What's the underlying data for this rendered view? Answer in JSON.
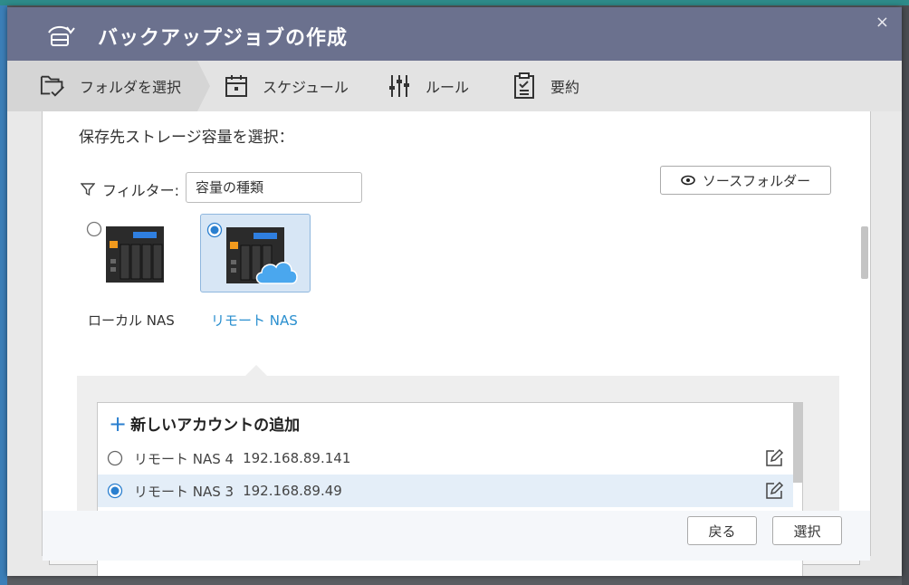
{
  "window": {
    "title": "バックアップジョブの作成",
    "close": "×"
  },
  "steps": [
    {
      "label": "フォルダを選択",
      "icon": "folder-check-icon"
    },
    {
      "label": "スケジュール",
      "icon": "calendar-icon"
    },
    {
      "label": "ルール",
      "icon": "sliders-icon"
    },
    {
      "label": "要約",
      "icon": "clipboard-icon"
    }
  ],
  "content": {
    "section_label": "保存先ストレージ容量を選択：",
    "filter_label": "フィルター:",
    "filter_value": "容量の種類",
    "source_folder_button": "ソースフォルダー",
    "storage_options": [
      {
        "label": "ローカル NAS",
        "selected": false
      },
      {
        "label": "リモート NAS",
        "selected": true
      }
    ],
    "add_account": "新しいアカウントの追加",
    "accounts": [
      {
        "name": "リモート NAS 4",
        "ip": "192.168.89.141",
        "selected": false
      },
      {
        "name": "リモート NAS 3",
        "ip": "192.168.89.49",
        "selected": true
      }
    ]
  },
  "footer": {
    "back": "戻る",
    "select": "選択"
  },
  "colors": {
    "titlebar": "#6b718e",
    "accent": "#2a8fcf"
  }
}
